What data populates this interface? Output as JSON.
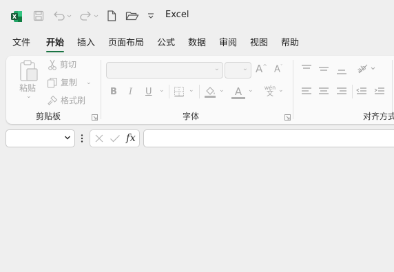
{
  "app": {
    "title": "Excel",
    "logo_letter": "X",
    "brand_color": "#1a7343"
  },
  "quick_access": {
    "icons": [
      "excel-logo-icon",
      "save-icon",
      "undo-icon",
      "redo-icon",
      "new-file-icon",
      "open-folder-icon",
      "customize-dropdown-icon"
    ]
  },
  "tabs": [
    {
      "label": "文件",
      "active": false
    },
    {
      "label": "开始",
      "active": true
    },
    {
      "label": "插入",
      "active": false
    },
    {
      "label": "页面布局",
      "active": false
    },
    {
      "label": "公式",
      "active": false
    },
    {
      "label": "数据",
      "active": false
    },
    {
      "label": "审阅",
      "active": false
    },
    {
      "label": "视图",
      "active": false
    },
    {
      "label": "帮助",
      "active": false
    }
  ],
  "clipboard": {
    "group_label": "剪贴板",
    "paste_label": "粘贴",
    "cut_label": "剪切",
    "copy_label": "复制",
    "format_painter_label": "格式刷"
  },
  "font": {
    "group_label": "字体",
    "font_name_value": "",
    "font_size_value": "",
    "bold": "B",
    "italic": "I",
    "underline": "U",
    "font_color_letter": "A",
    "phonetic_top": "wén",
    "phonetic_bottom": "文",
    "increase_font": "A",
    "decrease_font": "A"
  },
  "alignment": {
    "group_label": "对齐方式"
  },
  "formula_bar": {
    "name_box_value": "",
    "fx_label": "fx",
    "formula_value": ""
  }
}
